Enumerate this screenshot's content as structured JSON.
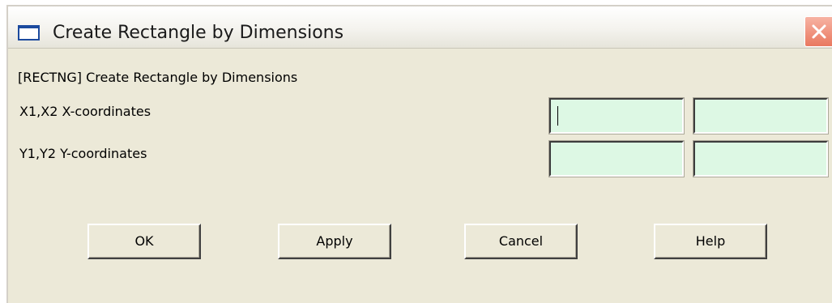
{
  "window": {
    "title": "Create Rectangle by Dimensions",
    "icon": "window-icon",
    "close_icon": "close-icon"
  },
  "command": {
    "label": "[RECTNG]  Create Rectangle by Dimensions"
  },
  "rows": [
    {
      "label": "X1,X2  X-coordinates",
      "field1_value": "",
      "field2_value": ""
    },
    {
      "label": "Y1,Y2  Y-coordinates",
      "field1_value": "",
      "field2_value": ""
    }
  ],
  "buttons": {
    "ok": "OK",
    "apply": "Apply",
    "cancel": "Cancel",
    "help": "Help"
  },
  "colors": {
    "input_background": "#ddf8e4",
    "dialog_background": "#ece9d8",
    "close_button": "#e9785f"
  }
}
